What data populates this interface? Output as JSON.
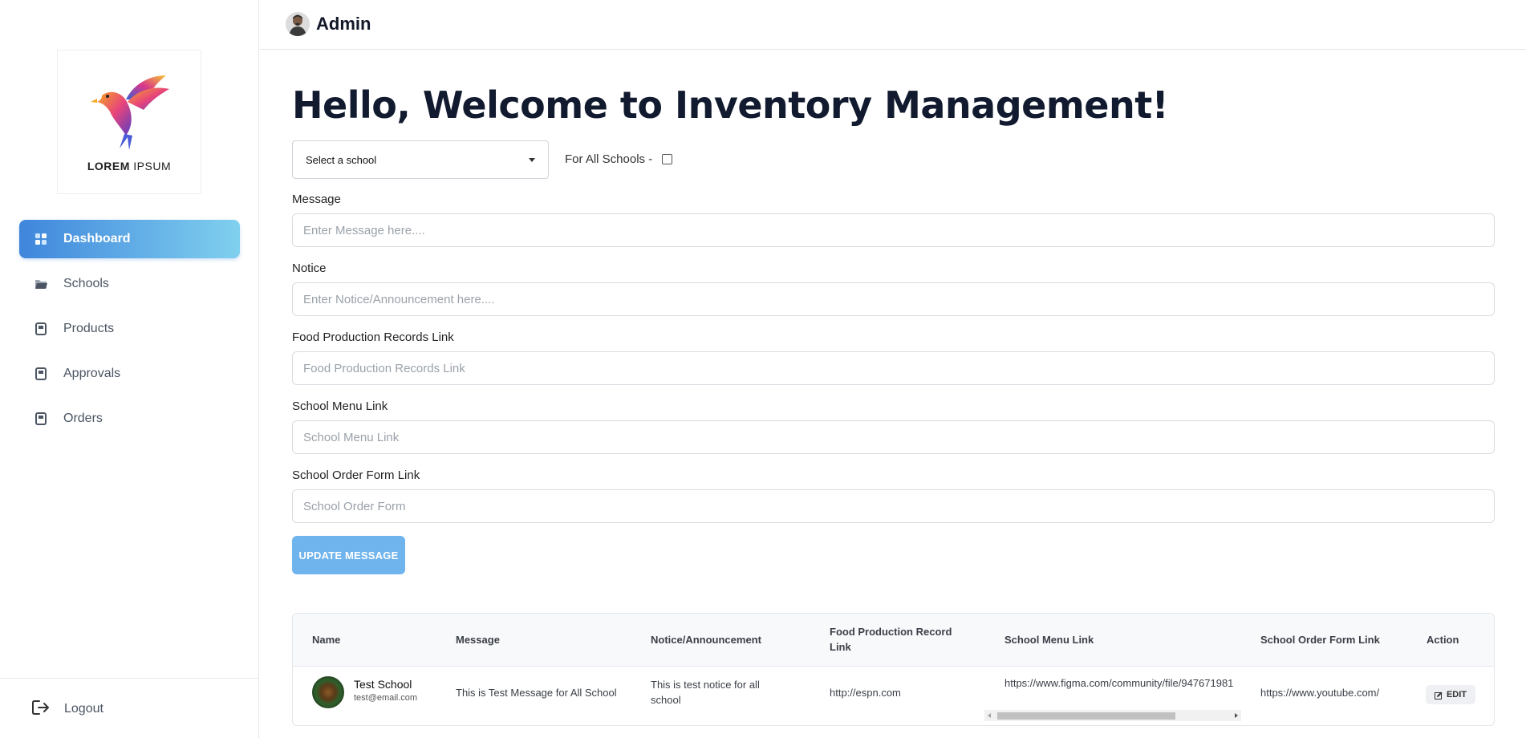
{
  "app": {
    "brand": {
      "logo_text_bold": "LOREM",
      "logo_text_light": "IPSUM"
    },
    "user": {
      "name": "Admin"
    }
  },
  "sidebar": {
    "items": [
      {
        "label": "Dashboard",
        "icon": "dashboard-grid-icon",
        "active": true
      },
      {
        "label": "Schools",
        "icon": "folder-icon",
        "active": false
      },
      {
        "label": "Products",
        "icon": "book-icon",
        "active": false
      },
      {
        "label": "Approvals",
        "icon": "book-icon",
        "active": false
      },
      {
        "label": "Orders",
        "icon": "book-icon",
        "active": false
      }
    ],
    "logout_label": "Logout"
  },
  "main": {
    "title": "Hello, Welcome to Inventory Management!",
    "school_select": {
      "value": "Select a school"
    },
    "all_schools_label": "For All Schools -",
    "fields": {
      "message": {
        "label": "Message",
        "placeholder": "Enter Message here...."
      },
      "notice": {
        "label": "Notice",
        "placeholder": "Enter Notice/Announcement here...."
      },
      "food_production": {
        "label": "Food Production Records Link",
        "placeholder": "Food Production Records Link"
      },
      "school_menu": {
        "label": "School Menu Link",
        "placeholder": "School Menu Link"
      },
      "order_form": {
        "label": "School Order Form Link",
        "placeholder": "School Order Form"
      }
    },
    "update_button": "UPDATE MESSAGE"
  },
  "table": {
    "headers": {
      "name": "Name",
      "message": "Message",
      "notice": "Notice/Announcement",
      "food_line1": "Food Production Record",
      "food_line2": "Link",
      "menu": "School Menu Link",
      "order": "School Order Form Link",
      "action": "Action"
    },
    "rows": [
      {
        "school_name": "Test School",
        "email": "test@email.com",
        "message": "This is Test Message for All School",
        "notice_line1": "This is test notice for all",
        "notice_line2": "school",
        "food_link": "http://espn.com",
        "menu_link": "https://www.figma.com/community/file/947671981",
        "order_link": "https://www.youtube.com/",
        "action": "EDIT"
      }
    ]
  },
  "colors": {
    "accent_gradient_start": "#3f86dc",
    "accent_gradient_end": "#80d0ef",
    "button_blue": "#70b4ee",
    "title_color": "#111a2e"
  }
}
